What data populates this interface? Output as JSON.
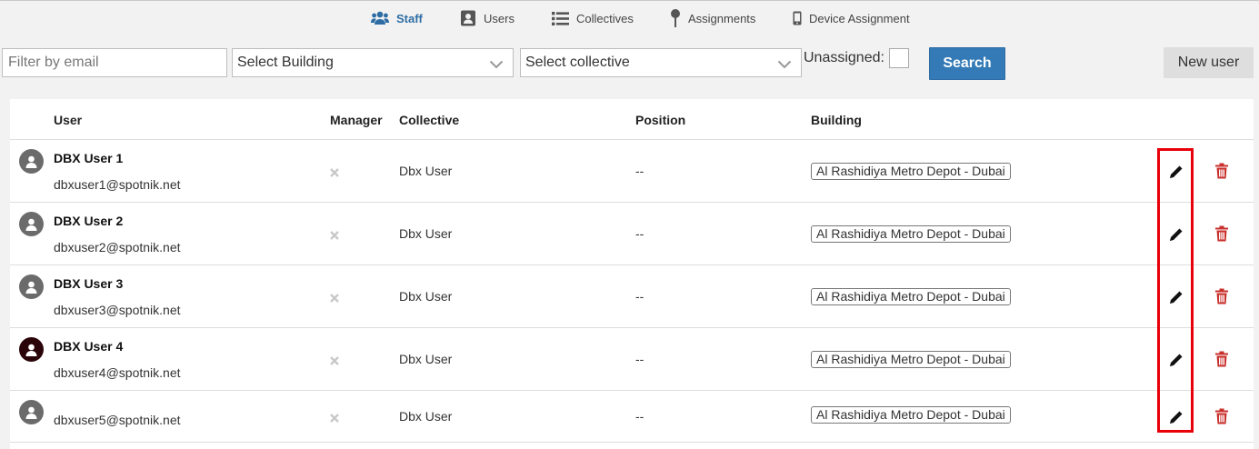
{
  "nav": {
    "items": [
      {
        "label": "Staff",
        "icon": "users-group-icon",
        "active": true
      },
      {
        "label": "Users",
        "icon": "address-book-icon"
      },
      {
        "label": "Collectives",
        "icon": "list-icon"
      },
      {
        "label": "Assignments",
        "icon": "map-pin-icon"
      },
      {
        "label": "Device Assignment",
        "icon": "mobile-icon"
      }
    ]
  },
  "filters": {
    "email_placeholder": "Filter by email",
    "building_select": "Select Building",
    "collective_select": "Select collective",
    "unassigned_label": "Unassigned:",
    "search_label": "Search",
    "new_user_label": "New user"
  },
  "table": {
    "headers": {
      "user": "User",
      "manager": "Manager",
      "collective": "Collective",
      "position": "Position",
      "building": "Building"
    },
    "rows": [
      {
        "name": "DBX User 1",
        "email": "dbxuser1@spotnik.net",
        "collective": "Dbx User",
        "position": "--",
        "building": "Al Rashidiya Metro Depot - Dubai"
      },
      {
        "name": "DBX User 2",
        "email": "dbxuser2@spotnik.net",
        "collective": "Dbx User",
        "position": "--",
        "building": "Al Rashidiya Metro Depot - Dubai"
      },
      {
        "name": "DBX User 3",
        "email": "dbxuser3@spotnik.net",
        "collective": "Dbx User",
        "position": "--",
        "building": "Al Rashidiya Metro Depot - Dubai"
      },
      {
        "name": "DBX User 4",
        "email": "dbxuser4@spotnik.net",
        "collective": "Dbx User",
        "position": "--",
        "building": "Al Rashidiya Metro Depot - Dubai"
      },
      {
        "name": "",
        "email": "dbxuser5@spotnik.net",
        "collective": "Dbx User",
        "position": "--",
        "building": "Al Rashidiya Metro Depot - Dubai"
      }
    ]
  },
  "colors": {
    "accent": "#337ab7",
    "delete": "#c9302c",
    "highlight": "#e8000b"
  }
}
